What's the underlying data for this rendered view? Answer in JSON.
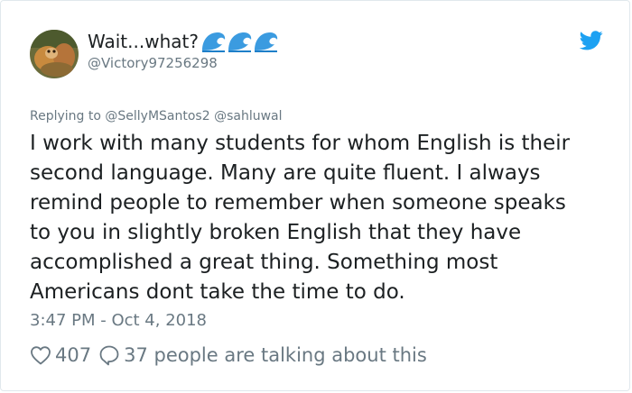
{
  "author": {
    "display_name": "Wait...what?",
    "handle": "@Victory97256298",
    "name_emoji": "wave-emoji"
  },
  "reply_context": {
    "prefix": "Replying to",
    "mentions": [
      "@SellyMSantos2",
      "@sahluwal"
    ]
  },
  "tweet": {
    "text": "I work with many students for whom English is their\nsecond language. Many are quite fluent. I always\nremind people to remember when someone speaks\nto you in slightly broken English that they have\naccomplished a great thing. Something most\nAmericans dont take the time to do.",
    "timestamp": "3:47 PM - Oct 4, 2018"
  },
  "engagement": {
    "likes": "407",
    "talking": "37 people are talking about this"
  },
  "colors": {
    "text": "#1c2022",
    "muted": "#697882",
    "twitter_blue": "#1da1f2",
    "wave_blue": "#3b9be0",
    "border": "#e1e8ed"
  },
  "icons": [
    "twitter-bird-icon",
    "heart-icon",
    "speech-bubble-icon"
  ]
}
